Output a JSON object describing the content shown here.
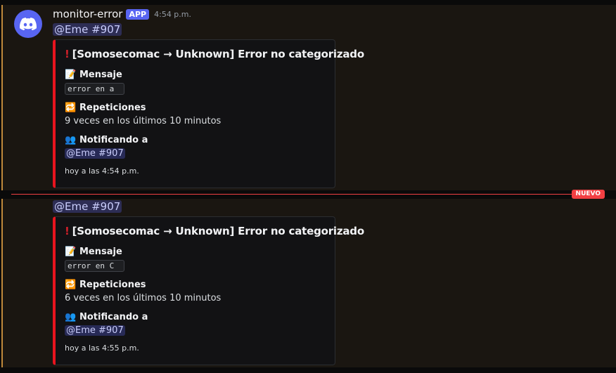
{
  "messages": [
    {
      "author": "monitor-error",
      "badge": "APP",
      "time": "4:54 p.m.",
      "mention": "@Eme #907",
      "embed": {
        "title_icon": "!",
        "title": "[Somosecomac → Unknown] Error no categorizado",
        "mensaje_label": "Mensaje",
        "mensaje_value": "error en a",
        "repeticiones_label": "Repeticiones",
        "repeticiones_value": "9 veces en los últimos 10 minutos",
        "notificando_label": "Notificando a",
        "notificando_value": "@Eme #907",
        "footer": "hoy a las 4:54 p.m."
      }
    },
    {
      "mention": "@Eme #907",
      "embed": {
        "title_icon": "!",
        "title": "[Somosecomac → Unknown] Error no categorizado",
        "mensaje_label": "Mensaje",
        "mensaje_value": "error en C",
        "repeticiones_label": "Repeticiones",
        "repeticiones_value": "6 veces en los últimos 10 minutos",
        "notificando_label": "Notificando a",
        "notificando_value": "@Eme #907",
        "footer": "hoy a las 4:55 p.m."
      }
    }
  ],
  "divider_label": "NUEVO",
  "colors": {
    "embed_accent": "#e8141e",
    "app_badge": "#5865f2",
    "new_divider": "#f23f43",
    "highlight_border": "#c0893b"
  },
  "icons": {
    "avatar": "discord-logo-icon",
    "title": "exclamation-icon",
    "mensaje": "memo-icon",
    "repeticiones": "repeat-icon",
    "notificando": "busts-icon"
  }
}
